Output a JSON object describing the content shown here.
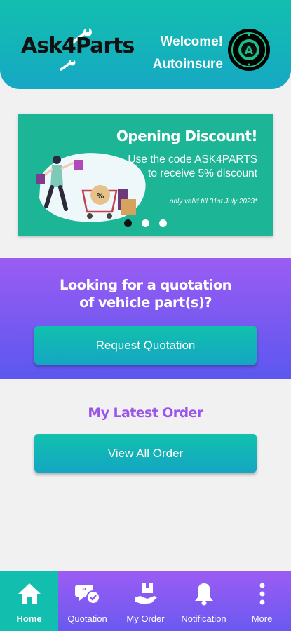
{
  "header": {
    "logo_text": "Ask4Parts",
    "welcome_line1": "Welcome!",
    "welcome_line2": "Autoinsure",
    "avatar_icon": "autoinsure-badge-icon"
  },
  "banner": {
    "title": "Opening Discount!",
    "text": "Use the code ASK4PARTS to receive 5% discount",
    "note": "only valid till 31st July 2023*",
    "illustration": "shopping-woman-illustration",
    "carousel_total": 3,
    "carousel_active": 1
  },
  "quotation": {
    "heading_line1": "Looking for a quotation",
    "heading_line2": "of vehicle part(s)?",
    "button_label": "Request Quotation"
  },
  "latest_order": {
    "title": "My Latest Order",
    "button_label": "View All Order"
  },
  "nav": {
    "items": [
      {
        "label": "Home",
        "icon": "home-icon",
        "active": true
      },
      {
        "label": "Quotation",
        "icon": "quotation-chat-icon",
        "active": false
      },
      {
        "label": "My Order",
        "icon": "order-box-icon",
        "active": false
      },
      {
        "label": "Notification",
        "icon": "bell-icon",
        "active": false
      },
      {
        "label": "More",
        "icon": "more-vertical-icon",
        "active": false
      }
    ]
  },
  "colors": {
    "teal": "#12bfae",
    "purple": "#9b5cf3",
    "banner_green": "#1cb596"
  }
}
